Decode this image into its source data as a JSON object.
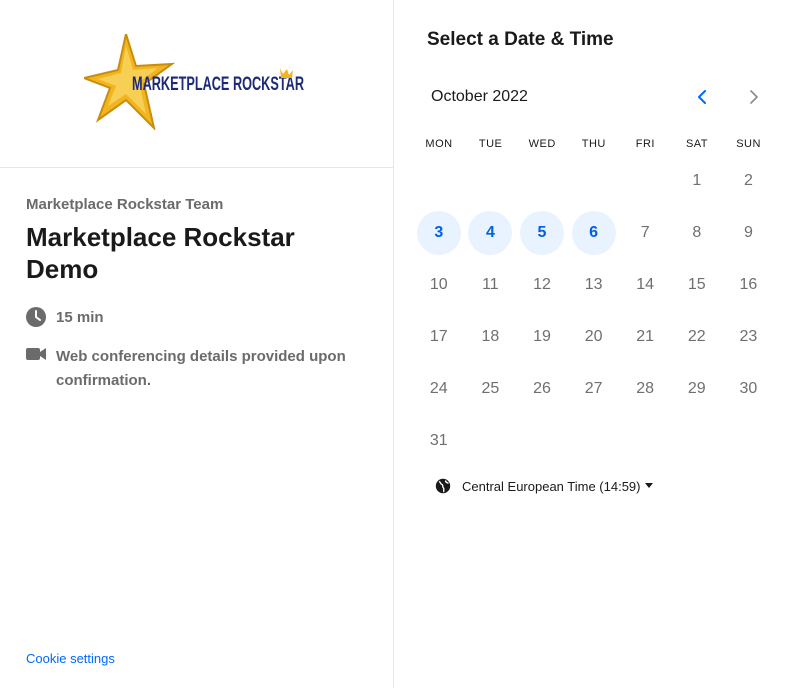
{
  "brand": {
    "logo_text": "MARKETPLACE ROCKSTAR",
    "logo_colors": {
      "star": "#f2b51f",
      "star_dark": "#c98d0c",
      "text": "#1d2a7a"
    }
  },
  "event": {
    "organizer": "Marketplace Rockstar Team",
    "title": "Marketplace Rockstar Demo",
    "duration": "15 min",
    "location": "Web conferencing details provided upon confirmation."
  },
  "footer": {
    "cookie_settings": "Cookie settings"
  },
  "calendar": {
    "heading": "Select a Date & Time",
    "month": "October 2022",
    "weekdays": [
      "MON",
      "TUE",
      "WED",
      "THU",
      "FRI",
      "SAT",
      "SUN"
    ],
    "first_weekday_index": 5,
    "days_in_month": 31,
    "available_days": [
      3,
      4,
      5,
      6
    ],
    "colors": {
      "accent": "#0060e6",
      "available_bg": "#e9f3ff",
      "muted": "#6f6f6f",
      "nav_active": "#0069ff",
      "nav_disabled": "#8a8a8a"
    }
  },
  "timezone": {
    "label": "Central European Time (14:59)"
  }
}
